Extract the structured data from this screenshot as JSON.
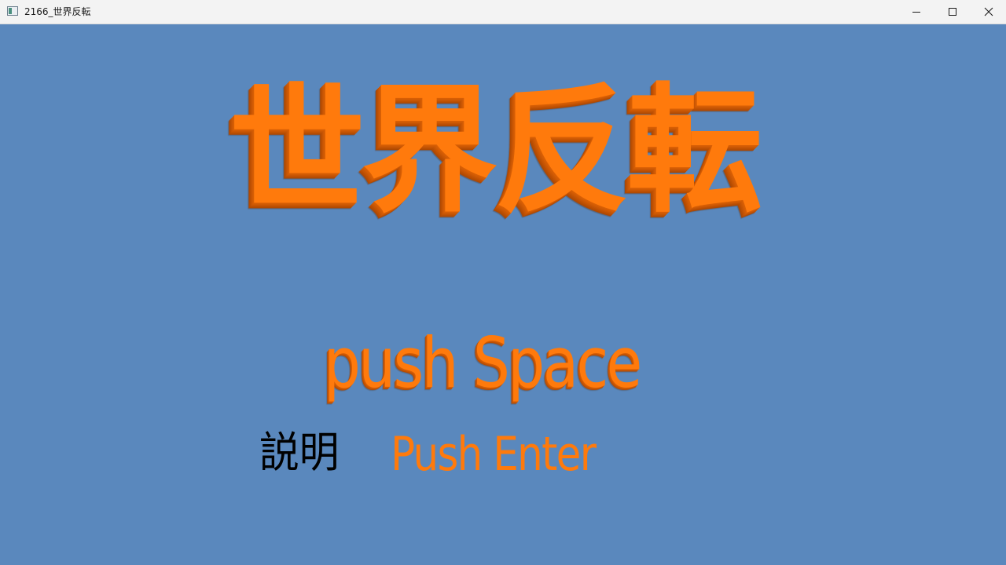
{
  "window": {
    "title": "2166_世界反転",
    "icon": "app-window-icon",
    "controls": {
      "minimize_icon": "minimize-icon",
      "maximize_icon": "maximize-icon",
      "close_icon": "close-icon"
    }
  },
  "screen": {
    "background_color": "#5a88bd",
    "accent_color": "#ff7a0c",
    "game_title": "世界反転",
    "start_prompt": "push Space",
    "manual_label": "説明",
    "manual_prompt": "Push Enter"
  }
}
